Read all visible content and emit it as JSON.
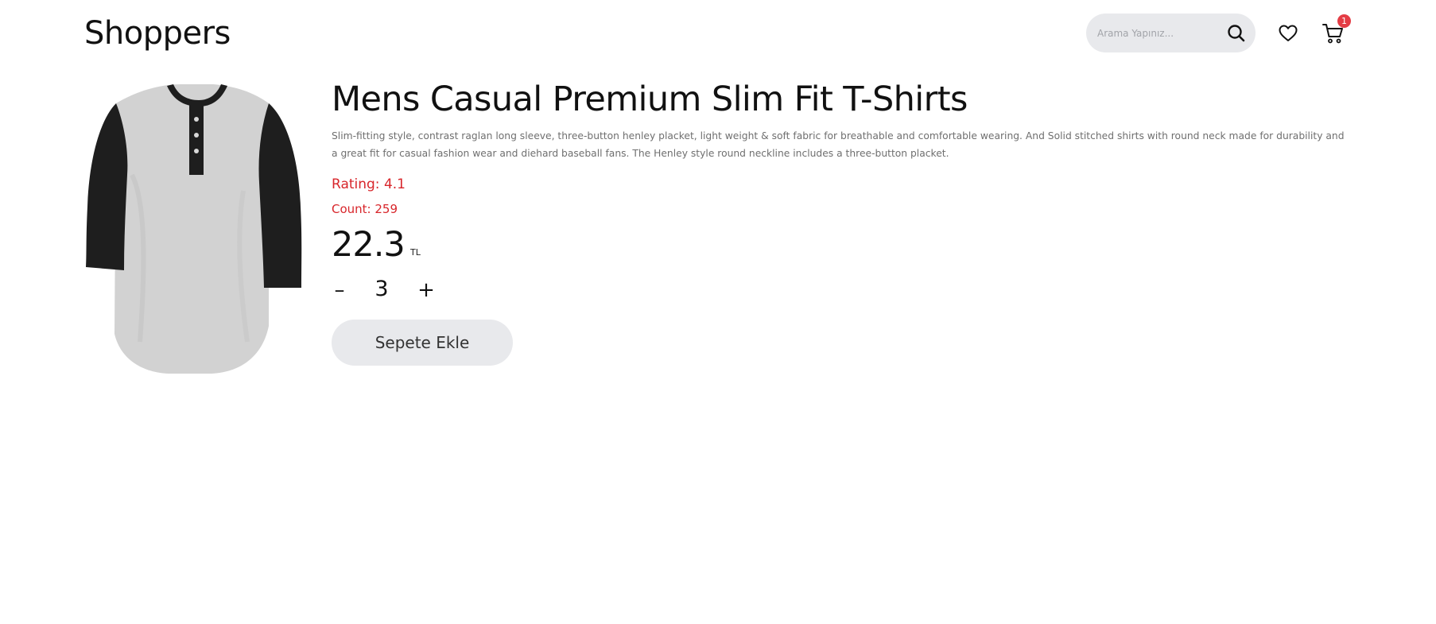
{
  "header": {
    "logo": "Shoppers",
    "search_placeholder": "Arama Yapınız...",
    "cart_count": "1"
  },
  "product": {
    "title": "Mens Casual Premium Slim Fit T-Shirts",
    "description": "Slim-fitting style, contrast raglan long sleeve, three-button henley placket, light weight & soft fabric for breathable and comfortable wearing. And Solid stitched shirts with round neck made for durability and a great fit for casual fashion wear and diehard baseball fans. The Henley style round neckline includes a three-button placket.",
    "rating": "Rating: 4.1",
    "count": "Count: 259",
    "price": "22.3",
    "currency": "TL",
    "quantity": "3",
    "minus_label": "–",
    "plus_label": "+",
    "add_to_cart_label": "Sepete Ekle"
  },
  "icons": {
    "search": "search-icon",
    "wishlist": "heart-icon",
    "cart": "cart-icon"
  },
  "colors": {
    "accent_red": "#d8262b",
    "badge_red": "#e43d45",
    "pill_bg": "#e8e9ec"
  }
}
